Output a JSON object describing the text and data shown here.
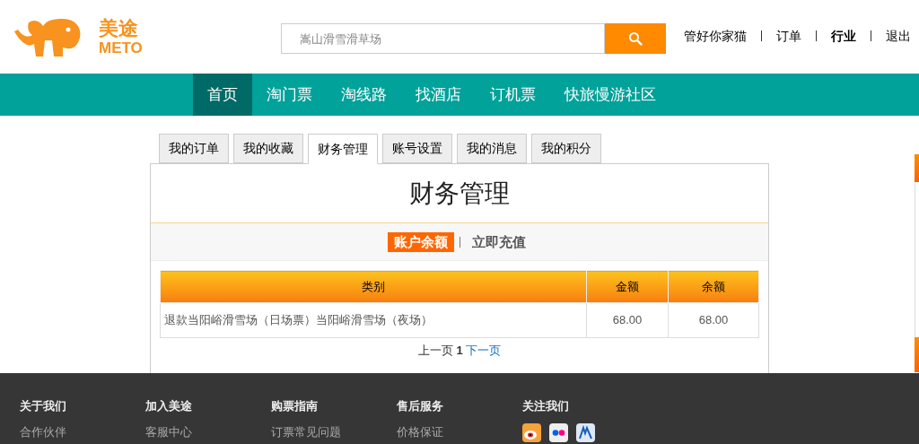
{
  "header": {
    "logo_text": "美途",
    "logo_subtext": "METO",
    "search": {
      "placeholder": "嵩山滑雪滑草场"
    },
    "user_links": [
      {
        "label": "管好你家猫",
        "bold": false
      },
      {
        "label": "订单",
        "bold": false
      },
      {
        "label": "行业",
        "bold": true
      },
      {
        "label": "退出",
        "bold": false
      }
    ]
  },
  "nav": [
    {
      "label": "首页",
      "selected": true
    },
    {
      "label": "淘门票",
      "selected": false
    },
    {
      "label": "淘线路",
      "selected": false
    },
    {
      "label": "找酒店",
      "selected": false
    },
    {
      "label": "订机票",
      "selected": false
    },
    {
      "label": "快旅慢游社区",
      "selected": false
    }
  ],
  "tabs": [
    {
      "label": "我的订单",
      "selected": false
    },
    {
      "label": "我的收藏",
      "selected": false
    },
    {
      "label": "财务管理",
      "selected": true
    },
    {
      "label": "账号设置",
      "selected": false
    },
    {
      "label": "我的消息",
      "selected": false
    },
    {
      "label": "我的积分",
      "selected": false
    }
  ],
  "panel": {
    "title": "财务管理",
    "subtabs": [
      {
        "label": "账户余额",
        "selected": true
      },
      {
        "label": "立即充值",
        "selected": false
      }
    ],
    "table": {
      "columns": [
        "类别",
        "金额",
        "余额"
      ],
      "rows": [
        [
          "退款当阳峪滑雪场（日场票）当阳峪滑雪场（夜场）",
          "68.00",
          "68.00"
        ]
      ]
    },
    "pager": {
      "prev": "上一页",
      "current": "1",
      "next": "下一页"
    }
  },
  "footer": {
    "columns": [
      {
        "heading": "关于我们",
        "links": [
          "合作伙伴"
        ]
      },
      {
        "heading": "加入美途",
        "links": [
          "客服中心"
        ]
      },
      {
        "heading": "购票指南",
        "links": [
          "订票常见问题"
        ]
      },
      {
        "heading": "售后服务",
        "links": [
          "价格保证"
        ]
      },
      {
        "heading": "关注我们",
        "social": [
          {
            "kind": "weibo"
          },
          {
            "kind": "flickr"
          },
          {
            "kind": "renren"
          }
        ]
      }
    ]
  }
}
